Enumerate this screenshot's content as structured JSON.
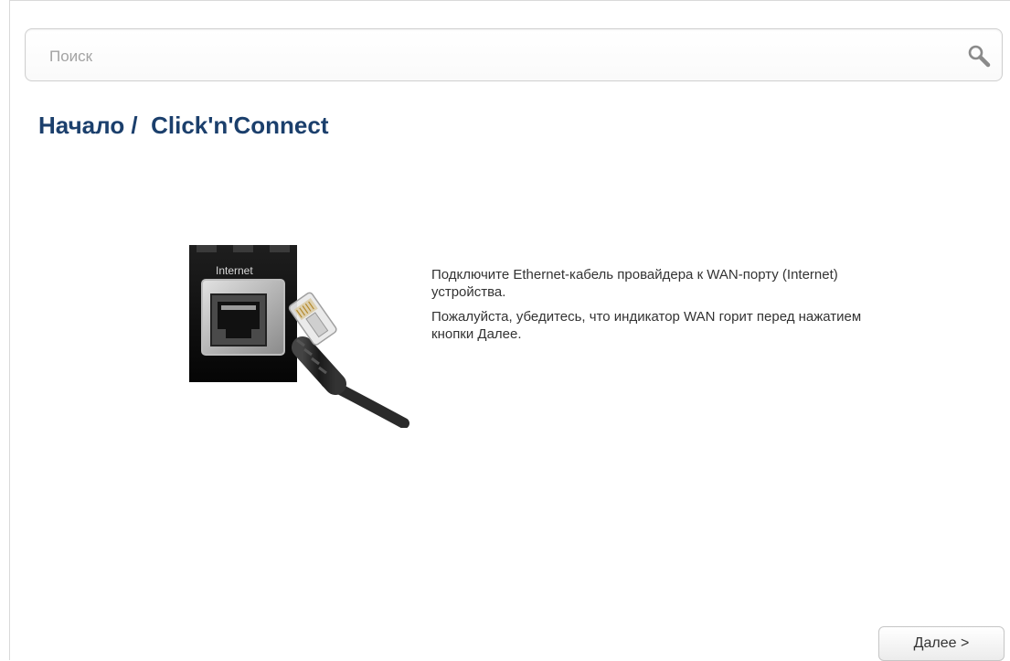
{
  "search": {
    "placeholder": "Поиск",
    "value": "",
    "icon": "search-icon"
  },
  "header": {
    "breadcrumb_root": "Начало /",
    "breadcrumb_current": "Click'n'Connect",
    "color": "#1b3f6c"
  },
  "illustration": {
    "port_label": "Internet",
    "icon": "ethernet-cable-port-image"
  },
  "instructions": {
    "line1": "Подключите Ethernet-кабель провайдера к WAN-порту (Internet) устройства.",
    "line2": "Пожалуйста, убедитесь, что индикатор WAN горит перед нажатием кнопки Далее."
  },
  "footer": {
    "next_label": "Далее >"
  }
}
